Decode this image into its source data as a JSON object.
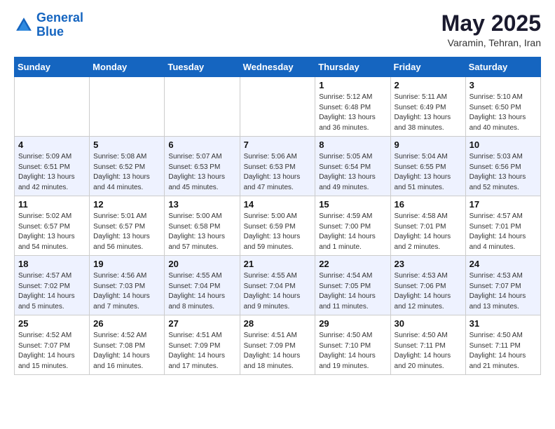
{
  "logo": {
    "line1": "General",
    "line2": "Blue"
  },
  "title": "May 2025",
  "subtitle": "Varamin, Tehran, Iran",
  "weekdays": [
    "Sunday",
    "Monday",
    "Tuesday",
    "Wednesday",
    "Thursday",
    "Friday",
    "Saturday"
  ],
  "weeks": [
    [
      {
        "day": "",
        "sunrise": "",
        "sunset": "",
        "daylight": ""
      },
      {
        "day": "",
        "sunrise": "",
        "sunset": "",
        "daylight": ""
      },
      {
        "day": "",
        "sunrise": "",
        "sunset": "",
        "daylight": ""
      },
      {
        "day": "",
        "sunrise": "",
        "sunset": "",
        "daylight": ""
      },
      {
        "day": "1",
        "sunrise": "Sunrise: 5:12 AM",
        "sunset": "Sunset: 6:48 PM",
        "daylight": "Daylight: 13 hours and 36 minutes."
      },
      {
        "day": "2",
        "sunrise": "Sunrise: 5:11 AM",
        "sunset": "Sunset: 6:49 PM",
        "daylight": "Daylight: 13 hours and 38 minutes."
      },
      {
        "day": "3",
        "sunrise": "Sunrise: 5:10 AM",
        "sunset": "Sunset: 6:50 PM",
        "daylight": "Daylight: 13 hours and 40 minutes."
      }
    ],
    [
      {
        "day": "4",
        "sunrise": "Sunrise: 5:09 AM",
        "sunset": "Sunset: 6:51 PM",
        "daylight": "Daylight: 13 hours and 42 minutes."
      },
      {
        "day": "5",
        "sunrise": "Sunrise: 5:08 AM",
        "sunset": "Sunset: 6:52 PM",
        "daylight": "Daylight: 13 hours and 44 minutes."
      },
      {
        "day": "6",
        "sunrise": "Sunrise: 5:07 AM",
        "sunset": "Sunset: 6:53 PM",
        "daylight": "Daylight: 13 hours and 45 minutes."
      },
      {
        "day": "7",
        "sunrise": "Sunrise: 5:06 AM",
        "sunset": "Sunset: 6:53 PM",
        "daylight": "Daylight: 13 hours and 47 minutes."
      },
      {
        "day": "8",
        "sunrise": "Sunrise: 5:05 AM",
        "sunset": "Sunset: 6:54 PM",
        "daylight": "Daylight: 13 hours and 49 minutes."
      },
      {
        "day": "9",
        "sunrise": "Sunrise: 5:04 AM",
        "sunset": "Sunset: 6:55 PM",
        "daylight": "Daylight: 13 hours and 51 minutes."
      },
      {
        "day": "10",
        "sunrise": "Sunrise: 5:03 AM",
        "sunset": "Sunset: 6:56 PM",
        "daylight": "Daylight: 13 hours and 52 minutes."
      }
    ],
    [
      {
        "day": "11",
        "sunrise": "Sunrise: 5:02 AM",
        "sunset": "Sunset: 6:57 PM",
        "daylight": "Daylight: 13 hours and 54 minutes."
      },
      {
        "day": "12",
        "sunrise": "Sunrise: 5:01 AM",
        "sunset": "Sunset: 6:57 PM",
        "daylight": "Daylight: 13 hours and 56 minutes."
      },
      {
        "day": "13",
        "sunrise": "Sunrise: 5:00 AM",
        "sunset": "Sunset: 6:58 PM",
        "daylight": "Daylight: 13 hours and 57 minutes."
      },
      {
        "day": "14",
        "sunrise": "Sunrise: 5:00 AM",
        "sunset": "Sunset: 6:59 PM",
        "daylight": "Daylight: 13 hours and 59 minutes."
      },
      {
        "day": "15",
        "sunrise": "Sunrise: 4:59 AM",
        "sunset": "Sunset: 7:00 PM",
        "daylight": "Daylight: 14 hours and 1 minute."
      },
      {
        "day": "16",
        "sunrise": "Sunrise: 4:58 AM",
        "sunset": "Sunset: 7:01 PM",
        "daylight": "Daylight: 14 hours and 2 minutes."
      },
      {
        "day": "17",
        "sunrise": "Sunrise: 4:57 AM",
        "sunset": "Sunset: 7:01 PM",
        "daylight": "Daylight: 14 hours and 4 minutes."
      }
    ],
    [
      {
        "day": "18",
        "sunrise": "Sunrise: 4:57 AM",
        "sunset": "Sunset: 7:02 PM",
        "daylight": "Daylight: 14 hours and 5 minutes."
      },
      {
        "day": "19",
        "sunrise": "Sunrise: 4:56 AM",
        "sunset": "Sunset: 7:03 PM",
        "daylight": "Daylight: 14 hours and 7 minutes."
      },
      {
        "day": "20",
        "sunrise": "Sunrise: 4:55 AM",
        "sunset": "Sunset: 7:04 PM",
        "daylight": "Daylight: 14 hours and 8 minutes."
      },
      {
        "day": "21",
        "sunrise": "Sunrise: 4:55 AM",
        "sunset": "Sunset: 7:04 PM",
        "daylight": "Daylight: 14 hours and 9 minutes."
      },
      {
        "day": "22",
        "sunrise": "Sunrise: 4:54 AM",
        "sunset": "Sunset: 7:05 PM",
        "daylight": "Daylight: 14 hours and 11 minutes."
      },
      {
        "day": "23",
        "sunrise": "Sunrise: 4:53 AM",
        "sunset": "Sunset: 7:06 PM",
        "daylight": "Daylight: 14 hours and 12 minutes."
      },
      {
        "day": "24",
        "sunrise": "Sunrise: 4:53 AM",
        "sunset": "Sunset: 7:07 PM",
        "daylight": "Daylight: 14 hours and 13 minutes."
      }
    ],
    [
      {
        "day": "25",
        "sunrise": "Sunrise: 4:52 AM",
        "sunset": "Sunset: 7:07 PM",
        "daylight": "Daylight: 14 hours and 15 minutes."
      },
      {
        "day": "26",
        "sunrise": "Sunrise: 4:52 AM",
        "sunset": "Sunset: 7:08 PM",
        "daylight": "Daylight: 14 hours and 16 minutes."
      },
      {
        "day": "27",
        "sunrise": "Sunrise: 4:51 AM",
        "sunset": "Sunset: 7:09 PM",
        "daylight": "Daylight: 14 hours and 17 minutes."
      },
      {
        "day": "28",
        "sunrise": "Sunrise: 4:51 AM",
        "sunset": "Sunset: 7:09 PM",
        "daylight": "Daylight: 14 hours and 18 minutes."
      },
      {
        "day": "29",
        "sunrise": "Sunrise: 4:50 AM",
        "sunset": "Sunset: 7:10 PM",
        "daylight": "Daylight: 14 hours and 19 minutes."
      },
      {
        "day": "30",
        "sunrise": "Sunrise: 4:50 AM",
        "sunset": "Sunset: 7:11 PM",
        "daylight": "Daylight: 14 hours and 20 minutes."
      },
      {
        "day": "31",
        "sunrise": "Sunrise: 4:50 AM",
        "sunset": "Sunset: 7:11 PM",
        "daylight": "Daylight: 14 hours and 21 minutes."
      }
    ]
  ]
}
